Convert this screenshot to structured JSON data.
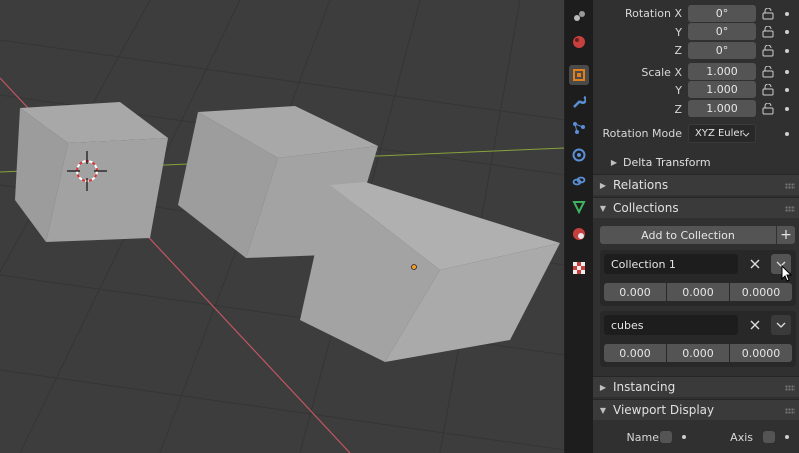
{
  "transform": {
    "rotation_x_label": "Rotation X",
    "rotation_x": "0°",
    "rotation_y_label": "Y",
    "rotation_y": "0°",
    "rotation_z_label": "Z",
    "rotation_z": "0°",
    "scale_x_label": "Scale X",
    "scale_x": "1.000",
    "scale_y_label": "Y",
    "scale_y": "1.000",
    "scale_z_label": "Z",
    "scale_z": "1.000",
    "rotation_mode_label": "Rotation Mode",
    "rotation_mode_value": "XYZ Euler",
    "delta_transform": "Delta Transform"
  },
  "panels": {
    "relations": "Relations",
    "collections": "Collections",
    "instancing": "Instancing",
    "viewport_display": "Viewport Display"
  },
  "collections": {
    "add_button": "Add to Collection",
    "items": [
      {
        "name": "Collection 1",
        "offset": [
          "0.000",
          "0.000",
          "0.0000"
        ]
      },
      {
        "name": "cubes",
        "offset": [
          "0.000",
          "0.000",
          "0.0000"
        ]
      }
    ]
  },
  "viewport_display": {
    "name_label": "Name",
    "axis_label": "Axis"
  },
  "colors": {
    "x_axis": "#c25563",
    "y_axis": "#86a33a",
    "accent_tab": "#e0801c"
  }
}
